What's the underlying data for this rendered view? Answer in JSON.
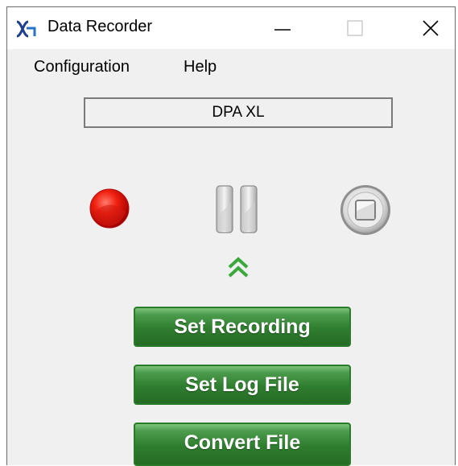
{
  "window": {
    "title": "Data Recorder",
    "icon": "data-recorder-app-icon",
    "controls": [
      "minimize-icon",
      "maximize-icon",
      "close-icon"
    ]
  },
  "menu": {
    "items": [
      {
        "label": "Configuration"
      },
      {
        "label": "Help"
      }
    ]
  },
  "device": {
    "name": "DPA XL"
  },
  "controls": {
    "record_icon": "record-icon",
    "pause_icon": "pause-icon",
    "stop_icon": "stop-icon",
    "expand_icon": "double-chevron-up-icon"
  },
  "actions": {
    "set_recording": "Set Recording",
    "set_log_file": "Set Log File",
    "convert_file": "Convert File"
  },
  "colors": {
    "accent_green": "#2f7d2f",
    "record_red": "#e01010",
    "chevron_green": "#3aa83a"
  }
}
